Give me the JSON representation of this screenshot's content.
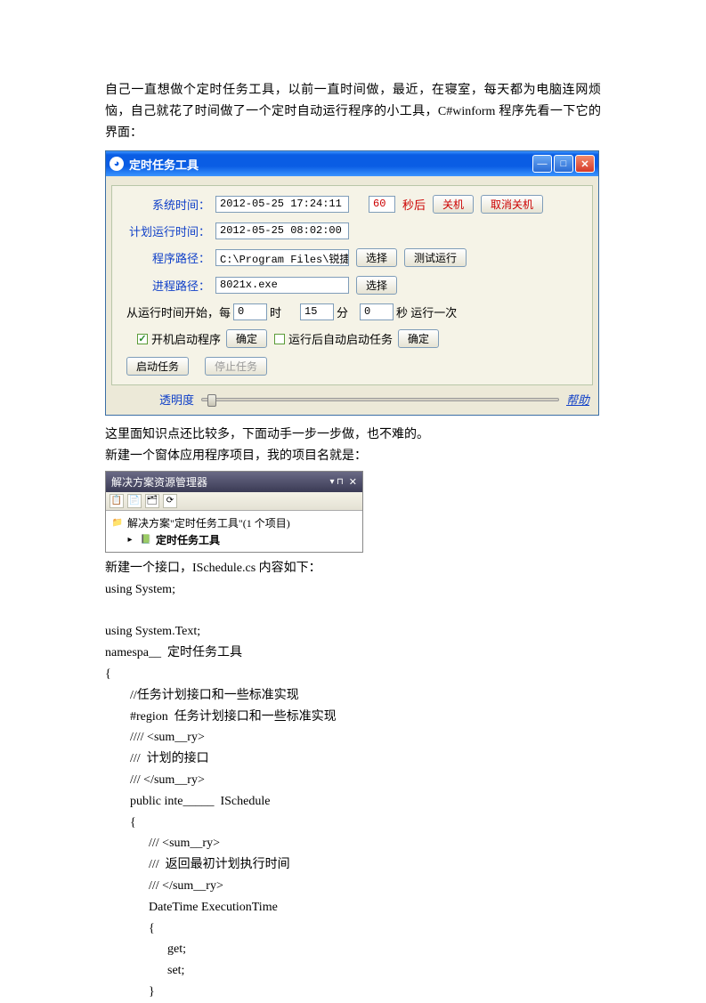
{
  "intro": "自己一直想做个定时任务工具，以前一直时间做，最近，在寝室，每天都为电脑连网烦恼，自己就花了时间做了一个定时自动运行程序的小工具，C#winform 程序先看一下它的界面：",
  "win": {
    "title": "定时任务工具",
    "labels": {
      "systime": "系统时间：",
      "plantime": "计划运行时间：",
      "progpath": "程序路径：",
      "procpath": "进程路径："
    },
    "fields": {
      "systime": "2012-05-25 17:24:11",
      "seconds": "60",
      "sec_suffix": "秒后",
      "shutdown": "关机",
      "cancel_shutdown": "取消关机",
      "plantime": "2012-05-25 08:02:00",
      "progpath": "C:\\Program Files\\锐捷网络",
      "choose": "选择",
      "testrun": "测试运行",
      "procpath": "8021x.exe"
    },
    "interval": {
      "prefix": "从运行时间开始，每",
      "hour_val": "0",
      "hour_lbl": "时",
      "min_val": "15",
      "min_lbl": "分",
      "sec_val": "0",
      "sec_lbl": "秒 运行一次"
    },
    "opts": {
      "boot": "开机启动程序",
      "confirm": "确定",
      "autostart": "运行后自动启动任务"
    },
    "task": {
      "start": "启动任务",
      "stop": "停止任务"
    },
    "opacity": "透明度",
    "help": "帮助"
  },
  "mid1": "这里面知识点还比较多，下面动手一步一步做，也不难的。",
  "mid2": "新建一个窗体应用程序项目，我的项目名就是：",
  "vs": {
    "title": "解决方案资源管理器",
    "solution": "解决方案\"定时任务工具\"(1 个项目)",
    "project": "定时任务工具"
  },
  "after_vs": "新建一个接口，ISchedule.cs 内容如下：",
  "code_lines": [
    "using System;",
    "",
    "using System.Text;",
    "namespa__  定时任务工具",
    "{",
    "        //任务计划接口和一些标准实现",
    "        #region  任务计划接口和一些标准实现",
    "        //// <sum__ry>",
    "        ///  计划的接口",
    "        /// </sum__ry>",
    "        public inte_____  ISchedule",
    "        {",
    "              /// <sum__ry>",
    "              ///  返回最初计划执行时间",
    "              /// </sum__ry>",
    "              DateTime ExecutionTime",
    "              {",
    "                    get;",
    "                    set;",
    "              }"
  ]
}
